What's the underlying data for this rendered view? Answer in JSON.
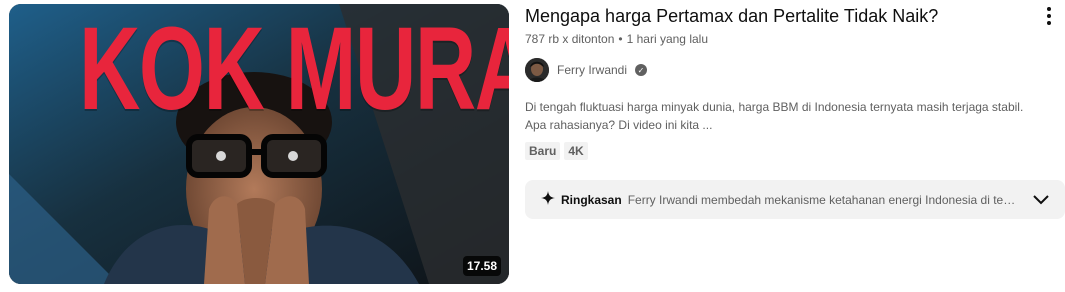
{
  "video": {
    "thumbnail_overlay_text": "KOK MURAH?",
    "duration": "17.58",
    "title": "Mengapa harga Pertamax dan Pertalite Tidak Naik?",
    "views": "787 rb x ditonton",
    "separator": "•",
    "uploaded": "1 hari yang lalu",
    "description": "Di tengah fluktuasi harga minyak dunia, harga BBM di Indonesia ternyata masih terjaga stabil. Apa rahasianya? Di video ini kita ...",
    "badges": [
      "Baru",
      "4K"
    ]
  },
  "channel": {
    "name": "Ferry Irwandi",
    "verified": true
  },
  "summary": {
    "label": "Ringkasan",
    "text": "Ferry Irwandi membedah mekanisme ketahanan energi Indonesia di tengah..."
  },
  "icons": {
    "menu": "more-vert-icon",
    "verified": "check-circle-icon",
    "summary": "sparkle-icon",
    "expand": "chevron-down-icon"
  },
  "colors": {
    "thumbnail_text": "#e8253c",
    "secondary_text": "#606060",
    "badge_bg": "#f2f2f2"
  }
}
